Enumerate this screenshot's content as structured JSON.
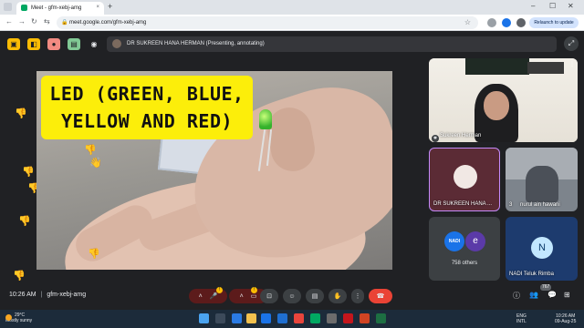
{
  "browser": {
    "tab_title": "Meet - gfm-xebj-amg",
    "tab_close": "×",
    "new_tab": "+",
    "url": "meet.google.com/gfm-xebj-amg",
    "update_label": "Relaunch to update",
    "nav": {
      "back": "←",
      "forward": "→",
      "reload": "↻",
      "site_info": "⇆"
    },
    "window_controls": {
      "minimize": "–",
      "maximize": "☐",
      "close": "✕"
    }
  },
  "presenter": {
    "label": "DR SUKREEN HANA HERMAN (Presenting, annotating)"
  },
  "slide": {
    "title_line1": "LED (GREEN, BLUE,",
    "title_line2": "YELLOW AND RED)"
  },
  "participants": {
    "self_name": "Sukreen Herman",
    "tile_a_name": "DR SUKREEN HANA ...",
    "tile_b_name": "nurul ain hawani",
    "tile_b_count": "3",
    "others_avatar_1": "NADI",
    "others_avatar_2": "e",
    "others_count": "758 others",
    "tile_d_initial": "N",
    "tile_d_name": "NADI Teluk Rimba",
    "people_badge": "767"
  },
  "meeting": {
    "time": "10:26 AM",
    "separator": "|",
    "code": "gfm-xebj-amg"
  },
  "taskbar": {
    "temperature": "29°C",
    "weather": "Mostly sunny",
    "lang_line1": "ENG",
    "lang_line2": "INTL",
    "clock_time": "10:26 AM",
    "clock_date": "09-Aug-25"
  },
  "colors": {
    "meet_bg": "#202124",
    "accent_yellow": "#fcee0a",
    "hangup_red": "#ea4335",
    "raise_hand_purple": "#c58af9"
  }
}
